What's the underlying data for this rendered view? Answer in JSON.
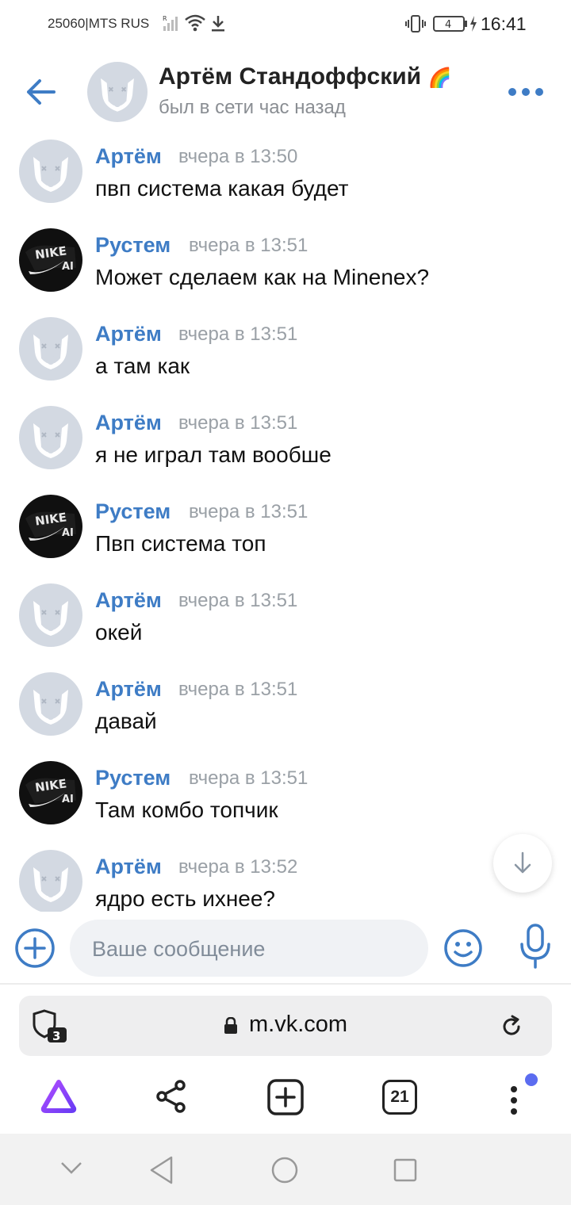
{
  "status_bar": {
    "carrier": "25060|MTS RUS",
    "battery": "4",
    "time": "16:41"
  },
  "header": {
    "name": "Артём Стандоффский",
    "badge_emoji": "🌈",
    "last_seen": "был в сети час назад"
  },
  "messages": [
    {
      "author": "Артём",
      "time": "вчера в 13:50",
      "text": "пвп система какая будет",
      "avatar": "default-dog-avatar"
    },
    {
      "author": "Рустем",
      "time": "вчера в 13:51",
      "text": "Может сделаем как на Minenex?",
      "avatar": "nike-photo-avatar"
    },
    {
      "author": "Артём",
      "time": "вчера в 13:51",
      "text": "а там как",
      "avatar": "default-dog-avatar"
    },
    {
      "author": "Артём",
      "time": "вчера в 13:51",
      "text": "я не играл там вообше",
      "avatar": "default-dog-avatar"
    },
    {
      "author": "Рустем",
      "time": "вчера в 13:51",
      "text": "Пвп система топ",
      "avatar": "nike-photo-avatar"
    },
    {
      "author": "Артём",
      "time": "вчера в 13:51",
      "text": "окей",
      "avatar": "default-dog-avatar"
    },
    {
      "author": "Артём",
      "time": "вчера в 13:51",
      "text": "давай",
      "avatar": "default-dog-avatar"
    },
    {
      "author": "Рустем",
      "time": "вчера в 13:51",
      "text": "Там комбо топчик",
      "avatar": "nike-photo-avatar"
    },
    {
      "author": "Артём",
      "time": "вчера в 13:52",
      "text": "ядро есть ихнее?",
      "avatar": "default-dog-avatar"
    }
  ],
  "composer": {
    "placeholder": "Ваше сообщение"
  },
  "browser": {
    "url": "m.vk.com",
    "shield_count": "3",
    "tabs_count": "21"
  },
  "colors": {
    "accent": "#3e7cc5",
    "avatar_bg": "#d3d9e2",
    "input_bg": "#f0f2f5",
    "alice_purple": "#8a3ffc",
    "notification_dot": "#5b6cf0"
  }
}
